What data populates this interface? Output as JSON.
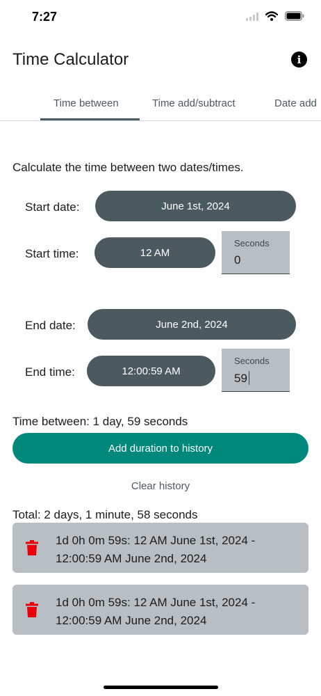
{
  "status_bar": {
    "time": "7:27"
  },
  "app": {
    "title": "Time Calculator"
  },
  "tabs": [
    {
      "label": "Time between",
      "active": true
    },
    {
      "label": "Time add/subtract",
      "active": false
    },
    {
      "label": "Date add",
      "active": false
    }
  ],
  "calculator": {
    "description": "Calculate the time between two dates/times.",
    "start_date_label": "Start date:",
    "start_date_value": "June 1st, 2024",
    "start_time_label": "Start time:",
    "start_time_value": "12 AM",
    "start_seconds_label": "Seconds",
    "start_seconds_value": "0",
    "end_date_label": "End date:",
    "end_date_value": "June 2nd, 2024",
    "end_time_label": "End time:",
    "end_time_value": "12:00:59 AM",
    "end_seconds_label": "Seconds",
    "end_seconds_value": "59",
    "result": "Time between: 1 day, 59 seconds",
    "add_button": "Add duration to history",
    "clear_button": "Clear history",
    "total": "Total: 2 days, 1 minute, 58 seconds"
  },
  "history": [
    {
      "text": "1d 0h 0m 59s: 12 AM June 1st, 2024 - 12:00:59 AM June 2nd, 2024"
    },
    {
      "text": "1d 0h 0m 59s: 12 AM June 1st, 2024 - 12:00:59 AM June 2nd, 2024"
    }
  ],
  "colors": {
    "pill": "#4b5960",
    "primary": "#00897b",
    "field_bg": "#b7bfc4",
    "delete": "#e8000b"
  }
}
